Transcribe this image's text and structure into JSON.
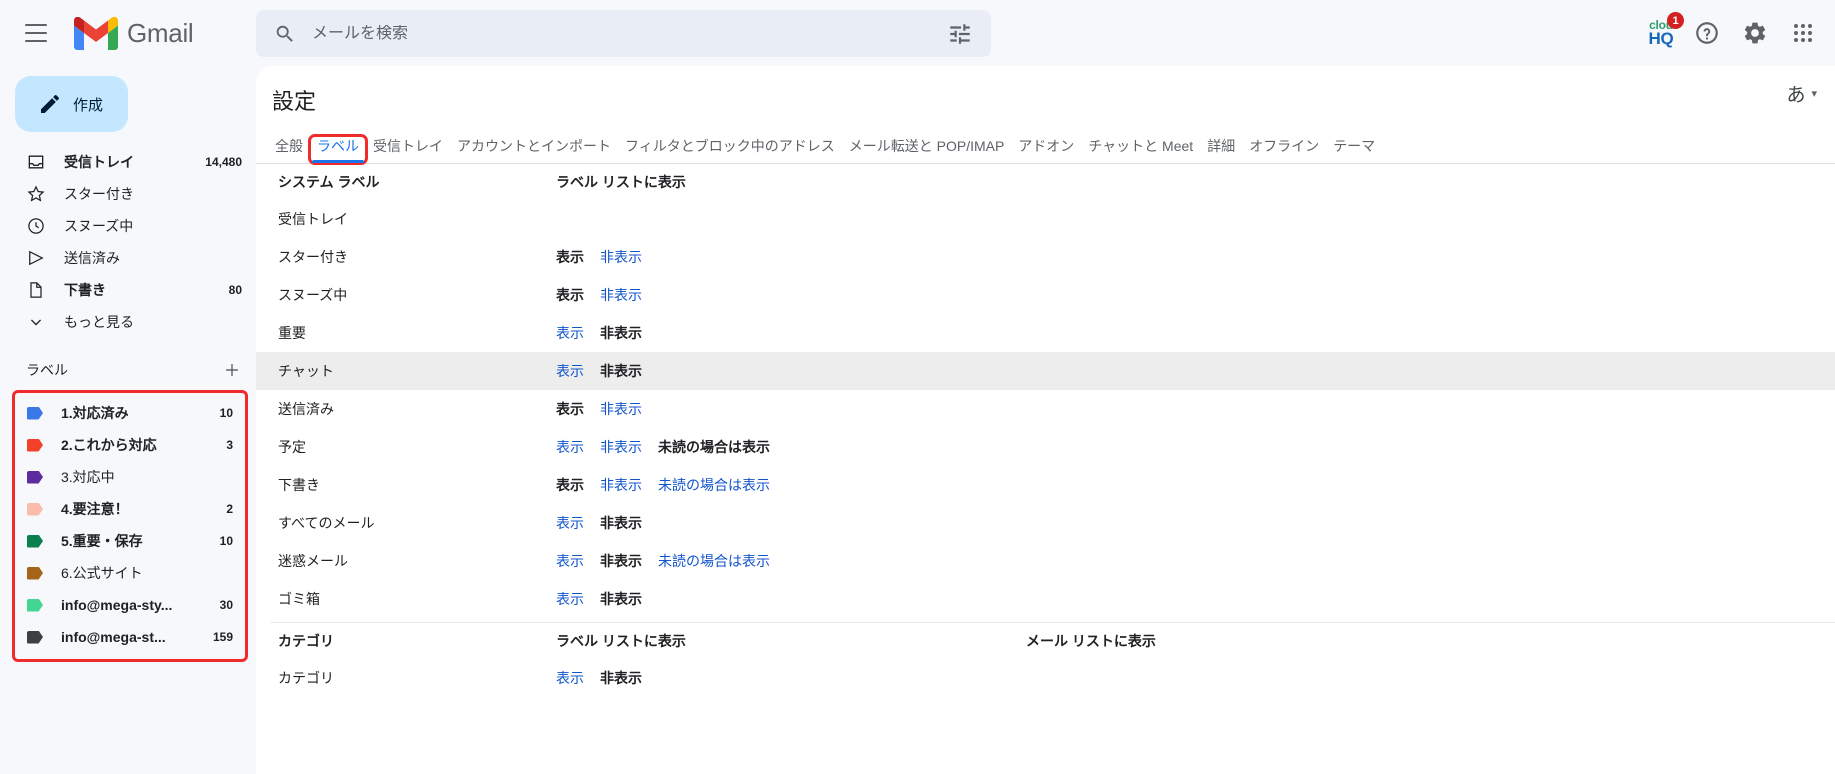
{
  "app": {
    "name": "Gmail"
  },
  "topbar": {
    "menu_icon": "hamburger-icon",
    "search_placeholder": "メールを検索",
    "search_value": "",
    "search_icon": "search-icon",
    "tune_icon": "tune-icon",
    "cloudhq": {
      "line1": "clou",
      "line2": "HQ",
      "badge": "1"
    },
    "help_icon": "help-icon",
    "settings_icon": "gear-icon",
    "apps_icon": "grid-apps-icon"
  },
  "sidebar": {
    "compose_label": "作成",
    "nav": [
      {
        "label": "受信トレイ",
        "count": "14,480",
        "icon": "inbox-icon",
        "bold": true
      },
      {
        "label": "スター付き",
        "count": "",
        "icon": "star-icon",
        "bold": false
      },
      {
        "label": "スヌーズ中",
        "count": "",
        "icon": "clock-icon",
        "bold": false
      },
      {
        "label": "送信済み",
        "count": "",
        "icon": "send-icon",
        "bold": false
      },
      {
        "label": "下書き",
        "count": "80",
        "icon": "draft-icon",
        "bold": true
      },
      {
        "label": "もっと見る",
        "count": "",
        "icon": "chevron-down-icon",
        "bold": false
      }
    ],
    "labels_title": "ラベル",
    "add_label_icon": "plus-icon",
    "labels": [
      {
        "name": "1.対応済み",
        "count": "10",
        "color": "#3b78e7",
        "bold": true
      },
      {
        "name": "2.これから対応",
        "count": "3",
        "color": "#f2402b",
        "bold": true
      },
      {
        "name": "3.対応中",
        "count": "",
        "color": "#5c2c9e",
        "bold": false
      },
      {
        "name": "4.要注意！",
        "count": "2",
        "color": "#fbbcaa",
        "bold": true
      },
      {
        "name": "5.重要・保存",
        "count": "10",
        "color": "#0b804f",
        "bold": true
      },
      {
        "name": "6.公式サイト",
        "count": "",
        "color": "#a4641a",
        "bold": false
      },
      {
        "name": "info@mega-sty...",
        "count": "30",
        "color": "#42d692",
        "bold": true
      },
      {
        "name": "info@mega-st...",
        "count": "159",
        "color": "#3c4043",
        "bold": true
      }
    ]
  },
  "main": {
    "title": "設定",
    "language_indicator": "あ",
    "language_caret": "▾",
    "tabs": [
      {
        "label": "全般",
        "active": false,
        "highlight": false
      },
      {
        "label": "ラベル",
        "active": true,
        "highlight": true
      },
      {
        "label": "受信トレイ",
        "active": false,
        "highlight": false
      },
      {
        "label": "アカウントとインポート",
        "active": false,
        "highlight": false
      },
      {
        "label": "フィルタとブロック中のアドレス",
        "active": false,
        "highlight": false
      },
      {
        "label": "メール転送と POP/IMAP",
        "active": false,
        "highlight": false
      },
      {
        "label": "アドオン",
        "active": false,
        "highlight": false
      },
      {
        "label": "チャットと Meet",
        "active": false,
        "highlight": false
      },
      {
        "label": "詳細",
        "active": false,
        "highlight": false
      },
      {
        "label": "オフライン",
        "active": false,
        "highlight": false
      },
      {
        "label": "テーマ",
        "active": false,
        "highlight": false
      }
    ],
    "system_section": {
      "col_name": "システム ラベル",
      "col_show_in_label_list": "ラベル リストに表示",
      "rows": [
        {
          "name": "受信トレイ",
          "actions": [],
          "hover": false
        },
        {
          "name": "スター付き",
          "actions": [
            {
              "label": "表示",
              "state": "on"
            },
            {
              "label": "非表示",
              "state": "link"
            }
          ],
          "hover": false
        },
        {
          "name": "スヌーズ中",
          "actions": [
            {
              "label": "表示",
              "state": "on"
            },
            {
              "label": "非表示",
              "state": "link"
            }
          ],
          "hover": false
        },
        {
          "name": "重要",
          "actions": [
            {
              "label": "表示",
              "state": "link"
            },
            {
              "label": "非表示",
              "state": "on"
            }
          ],
          "hover": false
        },
        {
          "name": "チャット",
          "actions": [
            {
              "label": "表示",
              "state": "link"
            },
            {
              "label": "非表示",
              "state": "on"
            }
          ],
          "hover": true
        },
        {
          "name": "送信済み",
          "actions": [
            {
              "label": "表示",
              "state": "on"
            },
            {
              "label": "非表示",
              "state": "link"
            }
          ],
          "hover": false
        },
        {
          "name": "予定",
          "actions": [
            {
              "label": "表示",
              "state": "link"
            },
            {
              "label": "非表示",
              "state": "link"
            },
            {
              "label": "未読の場合は表示",
              "state": "on"
            }
          ],
          "hover": false
        },
        {
          "name": "下書き",
          "actions": [
            {
              "label": "表示",
              "state": "on"
            },
            {
              "label": "非表示",
              "state": "link"
            },
            {
              "label": "未読の場合は表示",
              "state": "link"
            }
          ],
          "hover": false
        },
        {
          "name": "すべてのメール",
          "actions": [
            {
              "label": "表示",
              "state": "link"
            },
            {
              "label": "非表示",
              "state": "on"
            }
          ],
          "hover": false
        },
        {
          "name": "迷惑メール",
          "actions": [
            {
              "label": "表示",
              "state": "link"
            },
            {
              "label": "非表示",
              "state": "on"
            },
            {
              "label": "未読の場合は表示",
              "state": "link"
            }
          ],
          "hover": false
        },
        {
          "name": "ゴミ箱",
          "actions": [
            {
              "label": "表示",
              "state": "link"
            },
            {
              "label": "非表示",
              "state": "on"
            }
          ],
          "hover": false
        }
      ]
    },
    "category_section": {
      "col_name": "カテゴリ",
      "col_show_in_label_list": "ラベル リストに表示",
      "col_show_in_mail_list": "メール リストに表示",
      "rows": [
        {
          "name": "カテゴリ",
          "actions": [
            {
              "label": "表示",
              "state": "link"
            },
            {
              "label": "非表示",
              "state": "on"
            }
          ],
          "hover": false
        }
      ]
    }
  }
}
